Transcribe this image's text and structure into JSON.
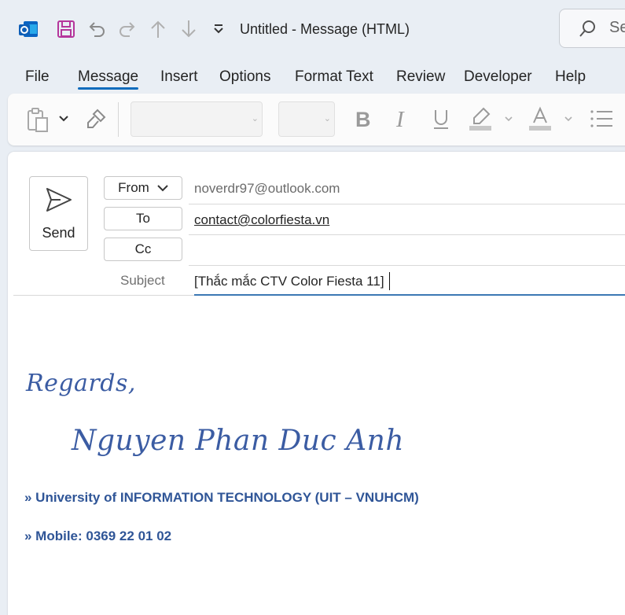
{
  "window": {
    "title": "Untitled  -  Message (HTML)",
    "search_label": "Se"
  },
  "menu": {
    "tabs": [
      "File",
      "Message",
      "Insert",
      "Options",
      "Format Text",
      "Review",
      "Developer",
      "Help"
    ],
    "active": "Message"
  },
  "compose": {
    "send_label": "Send",
    "from_label": "From",
    "from_value": "noverdr97@outlook.com",
    "to_label": "To",
    "to_value": "contact@colorfiesta.vn",
    "cc_label": "Cc",
    "cc_value": "",
    "subject_label": "Subject",
    "subject_value": "[Thắc mắc CTV Color Fiesta 11]"
  },
  "signature": {
    "regards": "Regards,",
    "name": "Nguyen Phan Duc Anh",
    "line1": "» University of INFORMATION TECHNOLOGY (UIT – VNUHCM)",
    "line2": "» Mobile: 0369 22 01 02"
  },
  "colors": {
    "accent": "#0f6cbd",
    "signature_script": "#3b5ca3",
    "signature_text": "#2f5597",
    "save_icon": "#b5359b"
  },
  "icons": [
    "outlook-logo-icon",
    "save-icon",
    "undo-icon",
    "redo-icon",
    "previous-item-icon",
    "next-item-icon",
    "customize-toolbar-icon",
    "search-icon",
    "paste-icon",
    "format-painter-icon",
    "bold-icon",
    "italic-icon",
    "underline-icon",
    "highlight-icon",
    "font-color-icon",
    "bullets-icon",
    "send-icon"
  ]
}
